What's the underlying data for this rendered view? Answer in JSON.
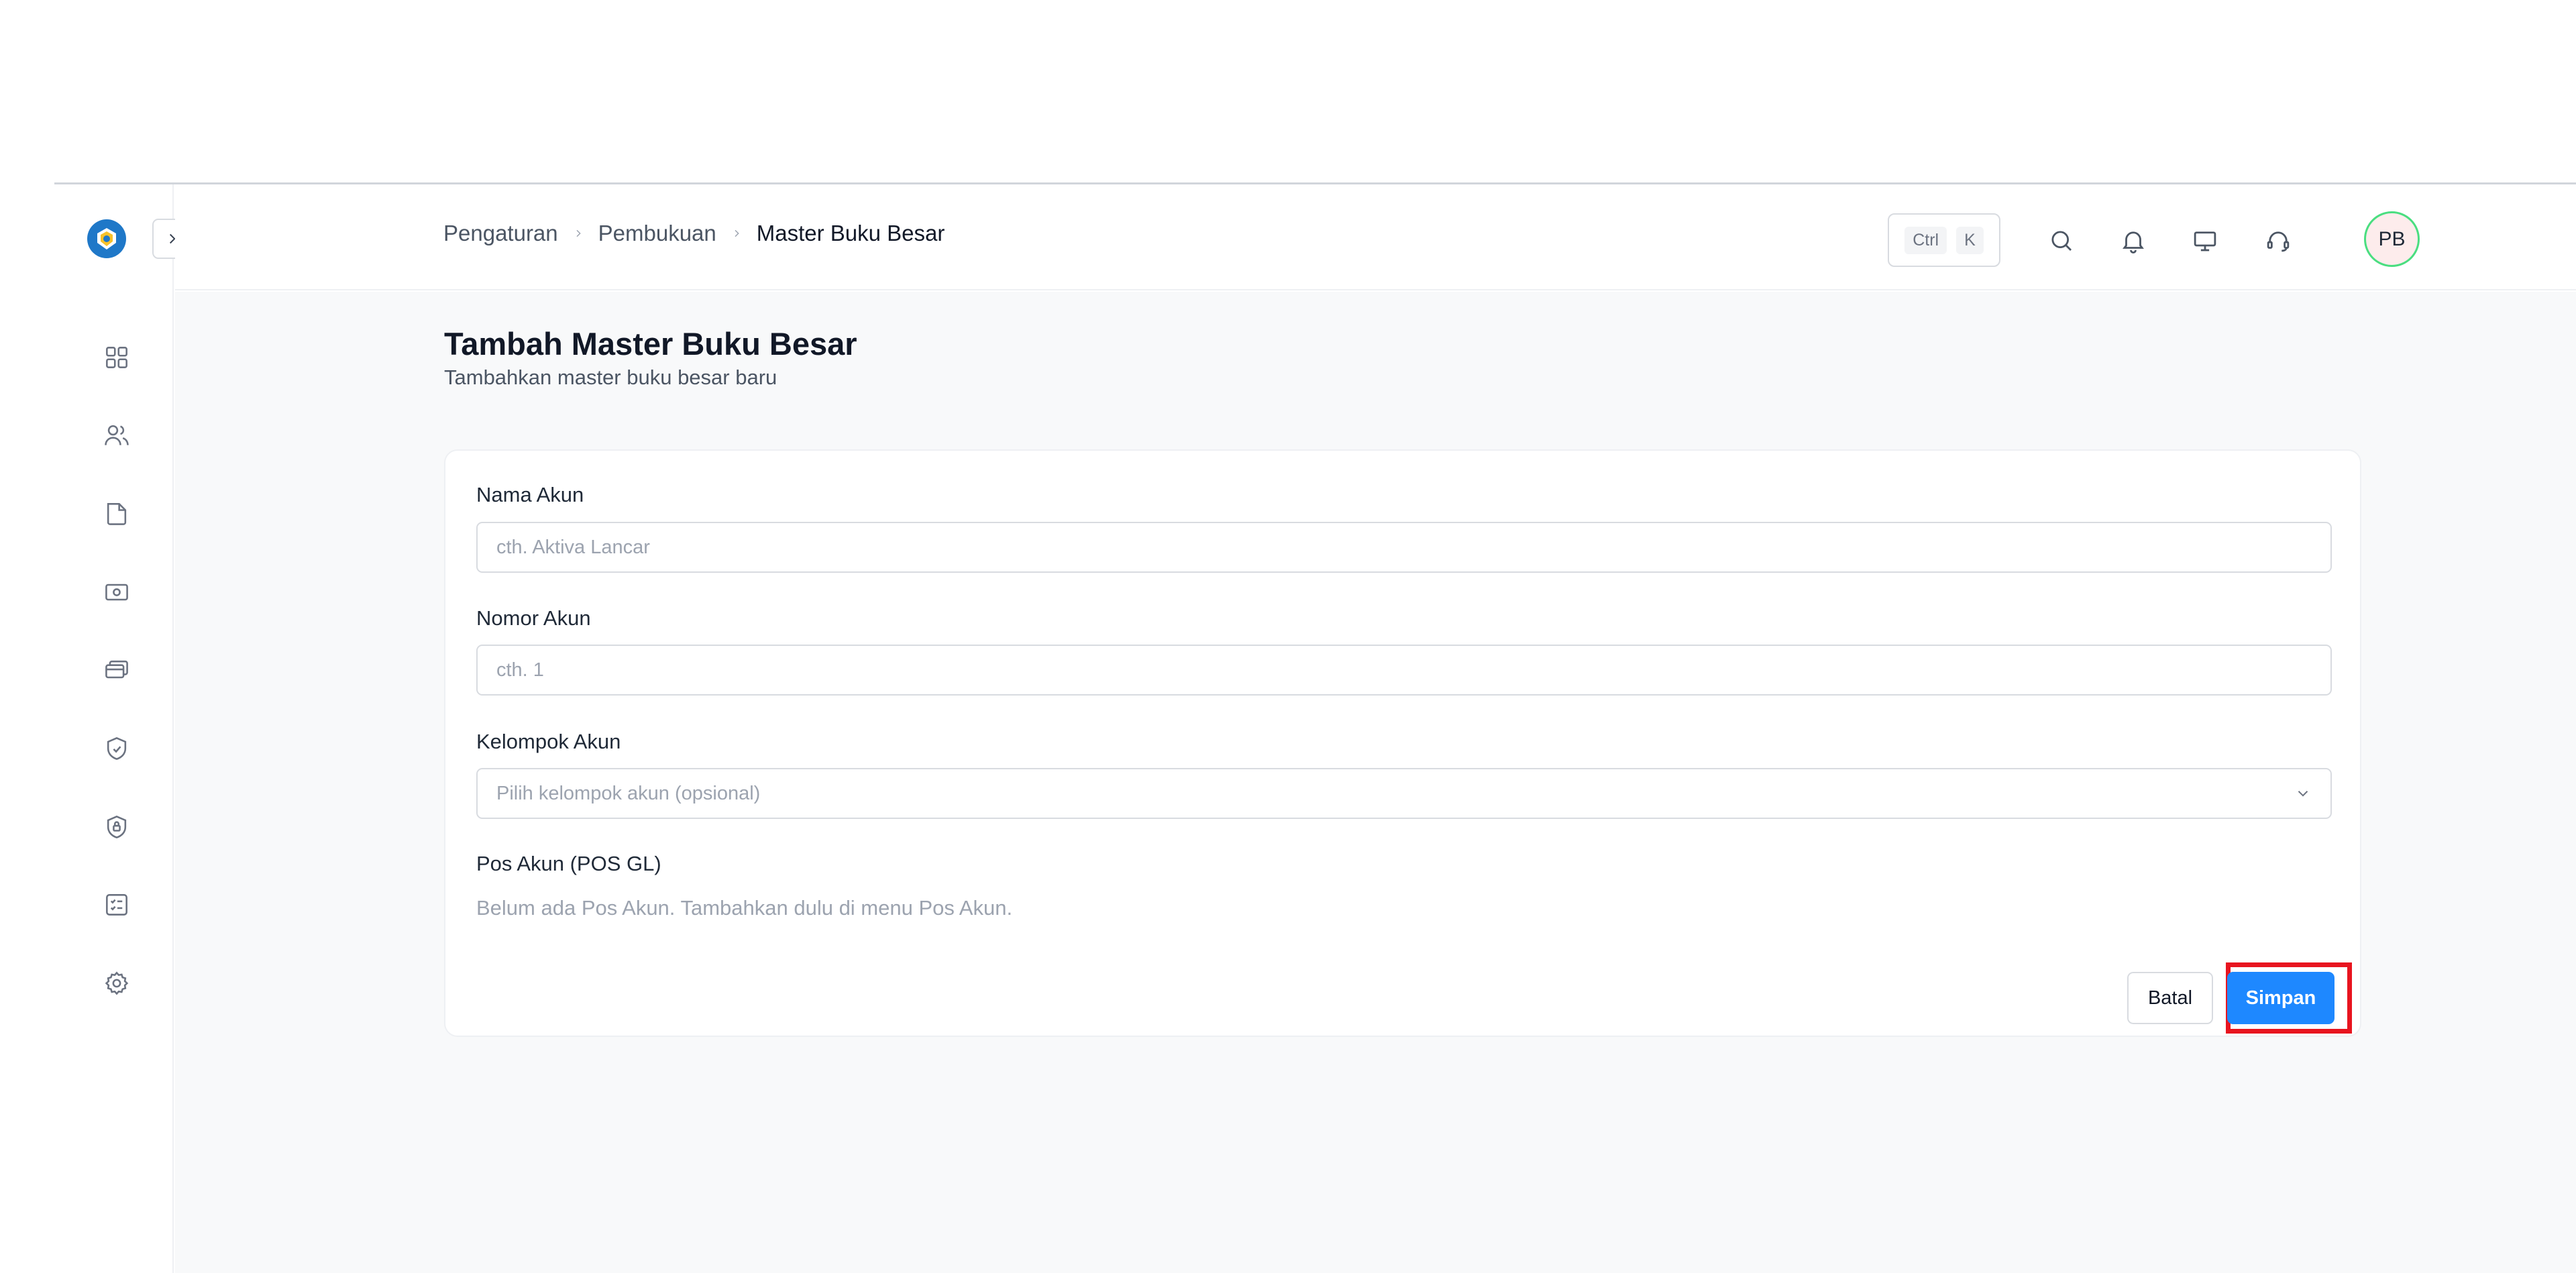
{
  "header": {
    "breadcrumb": [
      "Pengaturan",
      "Pembukuan",
      "Master Buku Besar"
    ],
    "shortcut_keys": [
      "Ctrl",
      "K"
    ],
    "user_initials": "PB"
  },
  "page": {
    "title": "Tambah Master Buku Besar",
    "subtitle": "Tambahkan master buku besar baru"
  },
  "form": {
    "account_name": {
      "label": "Nama Akun",
      "placeholder": "cth. Aktiva Lancar",
      "value": ""
    },
    "account_number": {
      "label": "Nomor Akun",
      "placeholder": "cth. 1",
      "value": ""
    },
    "account_group": {
      "label": "Kelompok Akun",
      "placeholder": "Pilih kelompok akun (opsional)"
    },
    "account_post": {
      "label": "Pos Akun (POS GL)",
      "empty_message": "Belum ada Pos Akun. Tambahkan dulu di menu Pos Akun."
    },
    "cancel_label": "Batal",
    "save_label": "Simpan"
  },
  "sidebar": {
    "icons": [
      "dashboard-icon",
      "users-icon",
      "folder-icon",
      "cash-icon",
      "cards-icon",
      "shield-icon",
      "lock-icon",
      "checklist-icon",
      "settings-icon"
    ]
  },
  "colors": {
    "primary": "#1e88ff",
    "highlight": "#e8141f",
    "logo": "#1f78c8",
    "avatar_ring": "#4ade80"
  }
}
